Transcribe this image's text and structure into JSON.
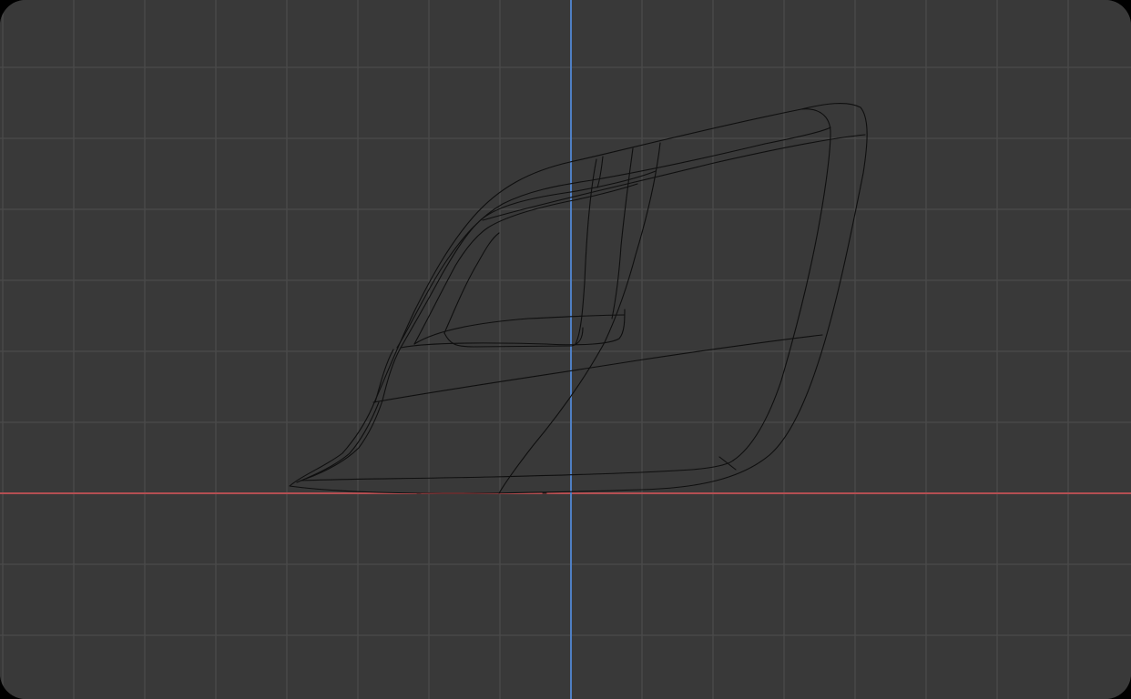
{
  "viewport": {
    "background_color": "#393939",
    "grid_color": "#4b4b4b",
    "x_axis_color": "#b44f52",
    "y_axis_color": "#4f7fc4",
    "wireframe_color": "#0f0f0f"
  }
}
